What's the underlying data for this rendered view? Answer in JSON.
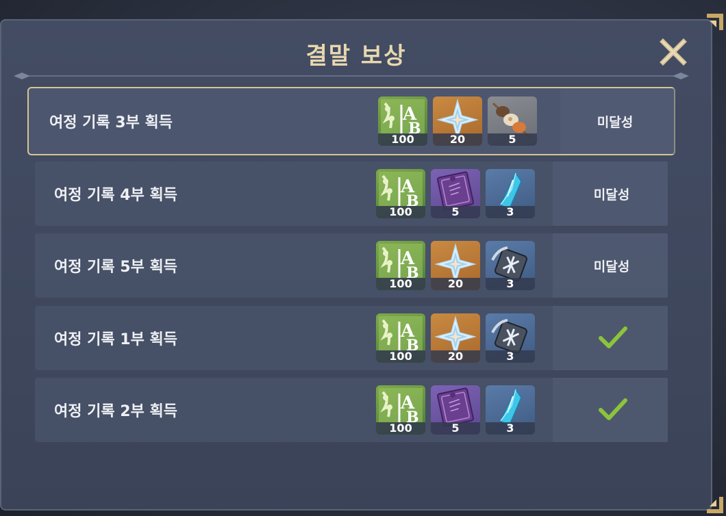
{
  "dialog": {
    "title": "결말 보상",
    "close_icon": "close-x-icon"
  },
  "rows": [
    {
      "label": "여정 기록 3부 획득",
      "status": "미달성",
      "completed": false,
      "rewards": [
        {
          "icon": "talent-book-icon",
          "count": "100"
        },
        {
          "icon": "primogem-icon",
          "count": "20"
        },
        {
          "icon": "skewer-food-icon",
          "count": "5"
        }
      ]
    },
    {
      "label": "여정 기록 4부 획득",
      "status": "미달성",
      "completed": false,
      "rewards": [
        {
          "icon": "talent-book-icon",
          "count": "100"
        },
        {
          "icon": "hero-wit-book-icon",
          "count": "5"
        },
        {
          "icon": "ore-crystal-icon",
          "count": "3"
        }
      ]
    },
    {
      "label": "여정 기록 5부 획득",
      "status": "미달성",
      "completed": false,
      "rewards": [
        {
          "icon": "talent-book-icon",
          "count": "100"
        },
        {
          "icon": "primogem-icon",
          "count": "20"
        },
        {
          "icon": "talent-material-icon",
          "count": "3"
        }
      ]
    },
    {
      "label": "여정 기록 1부 획득",
      "status": "",
      "completed": true,
      "rewards": [
        {
          "icon": "talent-book-icon",
          "count": "100"
        },
        {
          "icon": "primogem-icon",
          "count": "20"
        },
        {
          "icon": "talent-material-icon",
          "count": "3"
        }
      ]
    },
    {
      "label": "여정 기록 2부 획득",
      "status": "",
      "completed": true,
      "rewards": [
        {
          "icon": "talent-book-icon",
          "count": "100"
        },
        {
          "icon": "hero-wit-book-icon",
          "count": "5"
        },
        {
          "icon": "ore-crystal-icon",
          "count": "3"
        }
      ]
    }
  ],
  "colors": {
    "title": "#e8d8b0",
    "selected_border": "#d8c594",
    "check": "#8cc43a"
  }
}
